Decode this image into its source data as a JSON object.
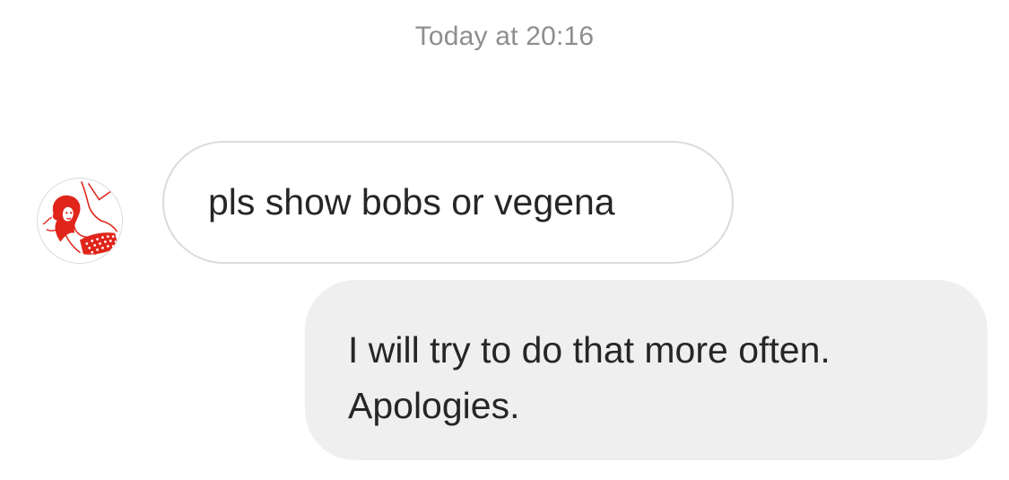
{
  "thread": {
    "timestamp": "Today at 20:16"
  },
  "messages": [
    {
      "direction": "incoming",
      "text": "pls show bobs or vegena",
      "sender_avatar_icon": "user-avatar-icon"
    },
    {
      "direction": "outgoing",
      "text": "I will try to do that more often.\nApologies."
    }
  ],
  "colors": {
    "timestamp": "#8e8e8e",
    "incoming_border": "#dbdbdb",
    "outgoing_background": "#efefef",
    "avatar_accent": "#e0251b"
  }
}
